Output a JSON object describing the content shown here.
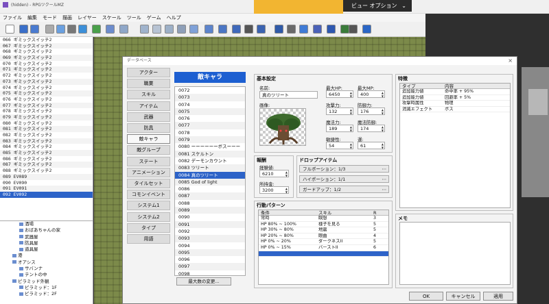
{
  "titlebar": {
    "app_title": "(hidden) - RPGツクールMZ",
    "view_options": "ビュー オプション"
  },
  "menu": [
    "ファイル",
    "編集",
    "モード",
    "描画",
    "レイヤー",
    "スケール",
    "ツール",
    "ゲーム",
    "ヘルプ"
  ],
  "switches": [
    "066 ギミックスイッチ2",
    "067 ギミックスイッチ2",
    "068 ギミックスイッチ2",
    "069 ギミックスイッチ2",
    "070 ギミックスイッチ2",
    "071 ギミックスイッチ2",
    "072 ギミックスイッチ2",
    "073 ギミックスイッチ2",
    "074 ギミックスイッチ2",
    "075 ギミックスイッチ2",
    "076 ギミックスイッチ2",
    "077 ギミックスイッチ2",
    "078 ギミックスイッチ2",
    "079 ギミックスイッチ2",
    "080 ギミックスイッチ2",
    "081 ギミックスイッチ2",
    "082 ギミックスイッチ2",
    "083 ギミックスイッチ2",
    "084 ギミックスイッチ2",
    "085 ギミックスイッチ2",
    "086 ギミックスイッチ2",
    "087 ギミックスイッチ2",
    "088 ギミックスイッチ2",
    "089 EV089",
    "090 EV090",
    "091 EV091",
    "092 EV092"
  ],
  "selected_switch": "092 EV092",
  "maptree": [
    {
      "indent": 2,
      "label": "酒場"
    },
    {
      "indent": 2,
      "label": "おばあちゃんの家"
    },
    {
      "indent": 2,
      "label": "武器屋"
    },
    {
      "indent": 2,
      "label": "防具屋"
    },
    {
      "indent": 2,
      "label": "道具屋"
    },
    {
      "indent": 1,
      "label": "港"
    },
    {
      "indent": 1,
      "label": "オアシス"
    },
    {
      "indent": 2,
      "label": "サバンナ"
    },
    {
      "indent": 2,
      "label": "テントの中"
    },
    {
      "indent": 1,
      "label": "ピラミッド外観"
    },
    {
      "indent": 2,
      "label": "ピラミッド：1F"
    },
    {
      "indent": 2,
      "label": "ピラミッド：2F"
    }
  ],
  "dialog": {
    "title": "データベース",
    "close": "×"
  },
  "categories": [
    "アクター",
    "職業",
    "スキル",
    "アイテム",
    "武器",
    "防具",
    "敵キャラ",
    "敵グループ",
    "ステート",
    "アニメーション",
    "タイルセット",
    "コモンイベント",
    "システム1",
    "システム2",
    "タイプ",
    "用語"
  ],
  "active_category": "敵キャラ",
  "enemy_header": "敵キャラ",
  "enemies": [
    "0072",
    "0073",
    "0074",
    "0075",
    "0076",
    "0077",
    "0078",
    "0079",
    "0080 ーーーーーーボスーーー",
    "0081 スケルトン",
    "0082 デーモンカウント",
    "0083 ツリート",
    "0084 真のツリート",
    "0085 God of light",
    "0086",
    "0087",
    "0088",
    "0089",
    "0090",
    "0091",
    "0092",
    "0093",
    "0094",
    "0095",
    "0096",
    "0097",
    "0098"
  ],
  "selected_enemy": "0084 真のツリート",
  "max_button": "最大数の変更...",
  "basic": {
    "title": "基本設定",
    "name_label": "名前:",
    "name": "真のツリート",
    "image_label": "画像:",
    "stats": [
      {
        "label": "最大HP:",
        "value": "6450"
      },
      {
        "label": "最大MP:",
        "value": "400"
      },
      {
        "label": "攻撃力:",
        "value": "132"
      },
      {
        "label": "防御力:",
        "value": "176"
      },
      {
        "label": "魔法力:",
        "value": "189"
      },
      {
        "label": "魔法防御:",
        "value": "174"
      },
      {
        "label": "敏捷性:",
        "value": "54"
      },
      {
        "label": "運:",
        "value": "61"
      }
    ]
  },
  "reward": {
    "title": "報酬",
    "exp_label": "経験値:",
    "exp": "6210",
    "gold_label": "所持金:",
    "gold": "3200"
  },
  "drops": {
    "title": "ドロップアイテム",
    "items": [
      "フルポーション：1/3",
      "ハイポーション：1/1",
      "ガードアップ：1/2"
    ]
  },
  "actions": {
    "title": "行動パターン",
    "headers": [
      "条件",
      "スキル",
      "R"
    ],
    "rows": [
      [
        "常時",
        "瞑想",
        "3"
      ],
      [
        "HP 80% ~ 100%",
        "様子を見る",
        "5"
      ],
      [
        "HP 30% ~ 80%",
        "地震",
        "5"
      ],
      [
        "HP 20% ~ 80%",
        "眼曲",
        "4"
      ],
      [
        "HP 0% ~ 20%",
        "ダークネスII",
        "5"
      ],
      [
        "HP 0% ~ 15%",
        "バーストII",
        "6"
      ]
    ]
  },
  "traits": {
    "title": "特徴",
    "headers": [
      "タイプ",
      "内容"
    ],
    "rows": [
      [
        "追加能力値",
        "命中率 + 95%"
      ],
      [
        "追加能力値",
        "回避率 + 5%"
      ],
      [
        "攻撃時属性",
        "物理"
      ],
      [
        "消滅エフェクト",
        "ボス"
      ]
    ]
  },
  "note": {
    "title": "メモ"
  },
  "buttons": {
    "ok": "OK",
    "cancel": "キャンセル",
    "apply": "適用"
  }
}
